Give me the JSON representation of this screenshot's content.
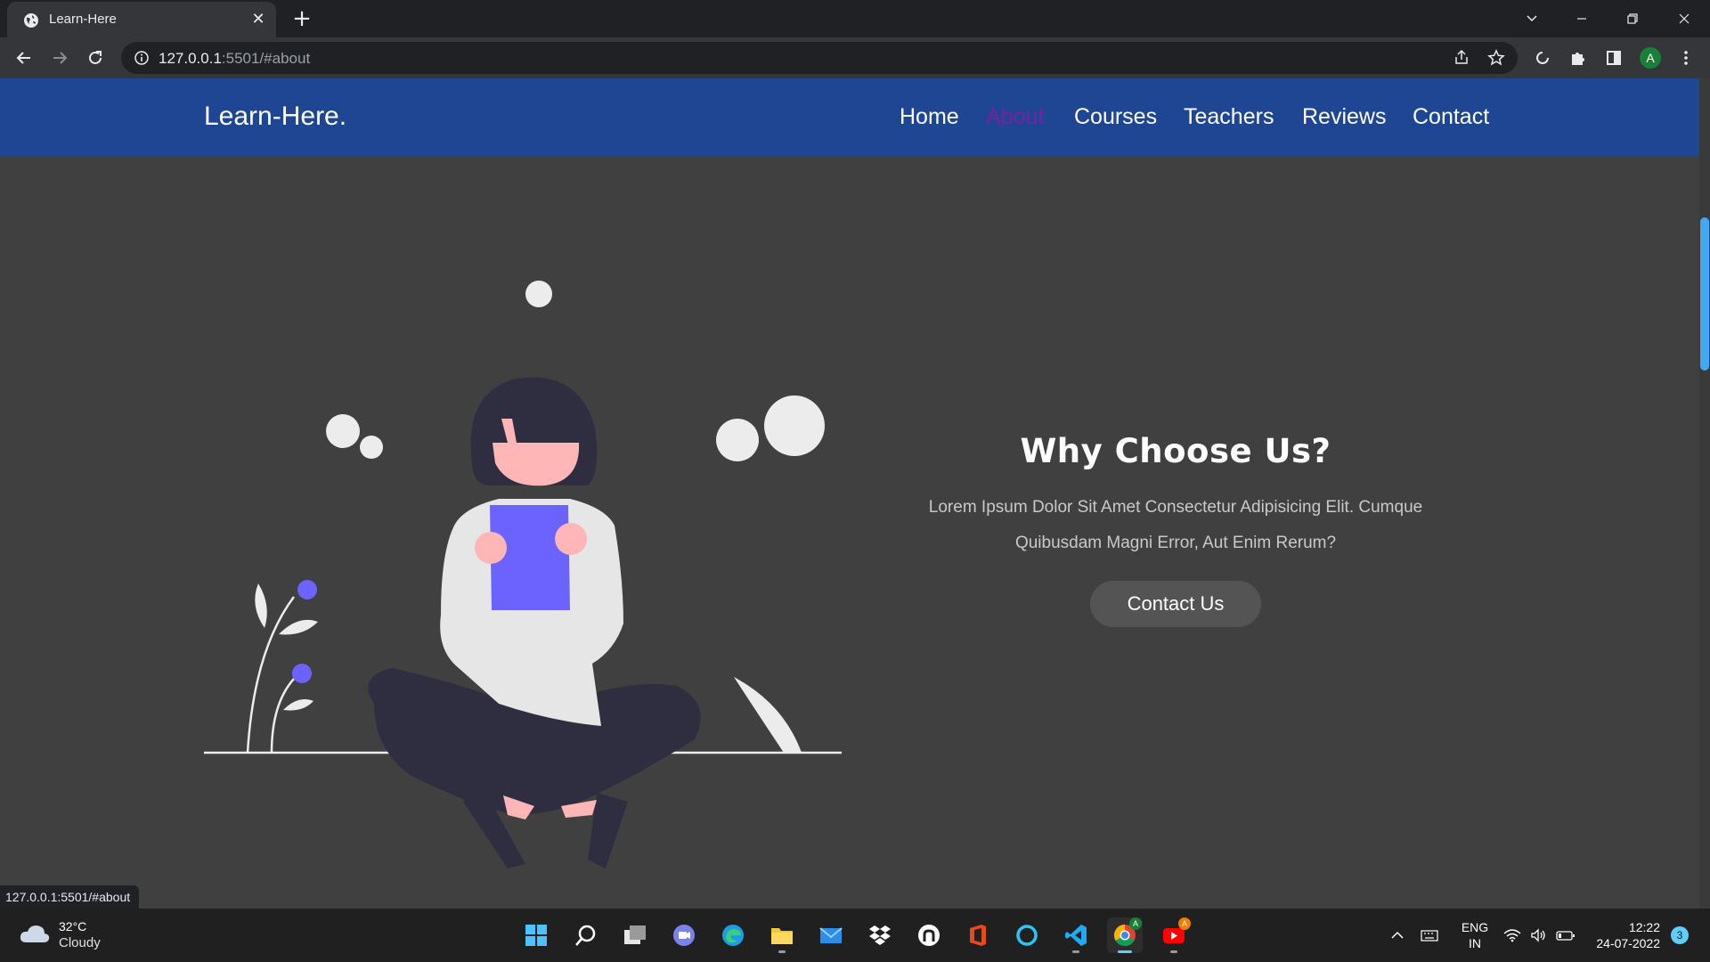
{
  "browser": {
    "tab_title": "Learn-Here",
    "tab_close": "✕",
    "new_tab": "+",
    "url_host": "127.0.0.1",
    "url_rest": ":5501/#about",
    "status_url": "127.0.0.1:5501/#about",
    "profile_initial": "A"
  },
  "site": {
    "logo": "Learn-Here.",
    "nav": [
      {
        "label": "Home",
        "active": false
      },
      {
        "label": "About",
        "active": true
      },
      {
        "label": "Courses",
        "active": false
      },
      {
        "label": "Teachers",
        "active": false
      },
      {
        "label": "Reviews",
        "active": false
      },
      {
        "label": "Contact",
        "active": false
      }
    ],
    "header_color": "#1f4693",
    "active_link_color": "#7b1fa2"
  },
  "about": {
    "title": "Why Choose Us?",
    "description_line1": "Lorem Ipsum Dolor Sit Amet Consectetur Adipisicing Elit. Cumque",
    "description_line2": "Quibusdam Magni Error, Aut Enim Rerum?",
    "button_label": "Contact Us",
    "accent_color": "#6c63ff"
  },
  "taskbar": {
    "weather_temp": "32°C",
    "weather_condition": "Cloudy",
    "language_line1": "ENG",
    "language_line2": "IN",
    "time": "12:22",
    "date": "24-07-2022",
    "notification_count": "3",
    "youtube_badge": "A",
    "chrome_badge": "A"
  }
}
